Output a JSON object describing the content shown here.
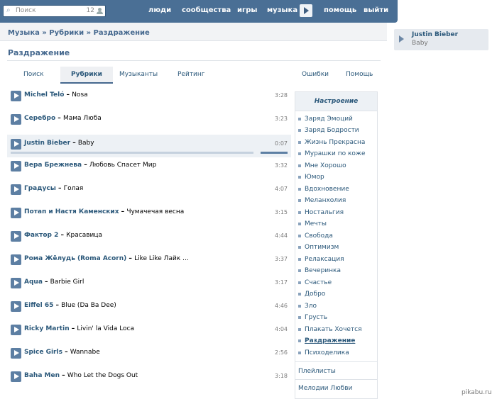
{
  "topbar": {
    "search_placeholder": "Поиск",
    "search_count": "12",
    "nav": [
      "люди",
      "сообщества",
      "игры",
      "музыка",
      "помощь",
      "выйти"
    ]
  },
  "breadcrumb": {
    "root": "Музыка",
    "sep": "»",
    "mid": "Рубрики",
    "current": "Раздражение"
  },
  "page_title": "Раздражение",
  "tabs": {
    "search": "Поиск",
    "rubrics": "Рубрики",
    "musicians": "Музыканты",
    "rating": "Рейтинг",
    "errors": "Ошибки",
    "help": "Помощь"
  },
  "tracks": [
    {
      "artist": "Michel Teló",
      "title": "Nosa",
      "duration": "3:28"
    },
    {
      "artist": "Серебро",
      "title": "Мама Люба",
      "duration": "3:23"
    },
    {
      "artist": "Justin Bieber",
      "title": "Baby",
      "duration": "0:07"
    },
    {
      "artist": "Вера Брежнева",
      "title": "Любовь Спасет Мир",
      "duration": "3:32"
    },
    {
      "artist": "Градусы",
      "title": "Голая",
      "duration": "4:07"
    },
    {
      "artist": "Потап и Настя Каменских",
      "title": "Чумачечая весна",
      "duration": "3:15"
    },
    {
      "artist": "Фактор 2",
      "title": "Красавица",
      "duration": "4:44"
    },
    {
      "artist": "Рома Жёлудь (Roma Acorn)",
      "title": "Like Like Лайк ...",
      "duration": "3:37"
    },
    {
      "artist": "Aqua",
      "title": "Barbie Girl",
      "duration": "3:17"
    },
    {
      "artist": "Eiffel 65",
      "title": "Blue (Da Ba Dee)",
      "duration": "4:46"
    },
    {
      "artist": "Ricky Martin",
      "title": "Livin' la Vida Loca",
      "duration": "4:04"
    },
    {
      "artist": "Spice Girls",
      "title": "Wannabe",
      "duration": "2:56"
    },
    {
      "artist": "Baha Men",
      "title": "Who Let the Dogs Out",
      "duration": "3:18"
    }
  ],
  "active_track_progress": 0.02,
  "sidebar": {
    "heading": "Настроение",
    "moods": [
      "Заряд Эмоций",
      "Заряд Бодрости",
      "Жизнь Прекрасна",
      "Мурашки по коже",
      "Мне Хорошо",
      "Юмор",
      "Вдохновение",
      "Меланхолия",
      "Ностальгия",
      "Мечты",
      "Свобода",
      "Оптимизм",
      "Релаксация",
      "Вечеринка",
      "Счастье",
      "Добро",
      "Зло",
      "Грусть",
      "Плакать Хочется",
      "Раздражение",
      "Психоделика"
    ],
    "selected": "Раздражение",
    "playlists": "Плейлисты",
    "love_melodies": "Мелодии Любви"
  },
  "now_playing": {
    "artist": "Justin Bieber",
    "song": "Baby"
  },
  "watermark": "pikabu.ru",
  "colors": {
    "header": "#4a6f95",
    "link": "#2b587a",
    "accent": "#5d7fa3"
  }
}
